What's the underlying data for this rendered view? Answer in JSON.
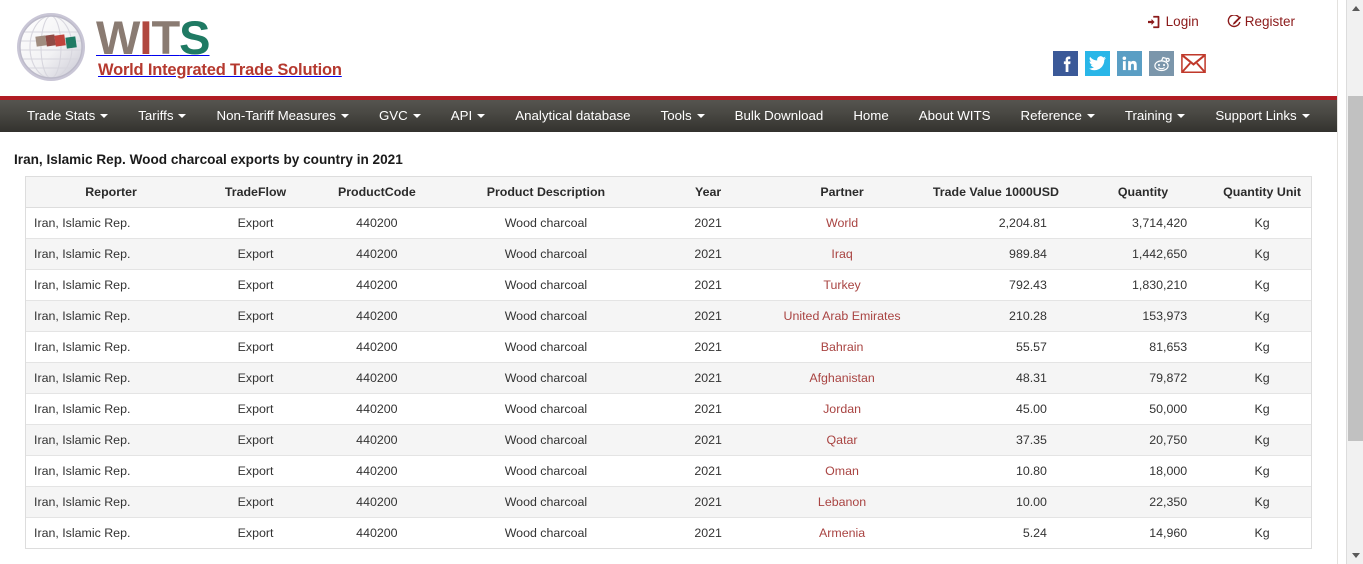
{
  "brand": {
    "logo_icon": "globe-icon",
    "name_parts": {
      "w": "W",
      "i": "I",
      "t": "T",
      "s": "S"
    },
    "tagline": "World Integrated Trade Solution",
    "colors": {
      "wits_w": "#8a7b72",
      "wits_i": "#b1483f",
      "wits_t": "#8a7b72",
      "wits_s": "#1f7a63",
      "tagline": "#b5392f"
    }
  },
  "auth": {
    "login": {
      "label": "Login",
      "icon": "sign-in-icon"
    },
    "register": {
      "label": "Register",
      "icon": "edit-pencil-icon"
    },
    "color": "#8b1a1a"
  },
  "social": [
    {
      "name": "facebook",
      "icon": "facebook-icon",
      "glyph": "f",
      "color": "#3b5998"
    },
    {
      "name": "twitter",
      "icon": "twitter-icon",
      "glyph": "t",
      "color": "#29b6e8"
    },
    {
      "name": "linkedin",
      "icon": "linkedin-icon",
      "glyph": "in",
      "color": "#5a9ec4"
    },
    {
      "name": "reddit",
      "icon": "reddit-icon",
      "glyph": "r",
      "color": "#7b96ab"
    },
    {
      "name": "email",
      "icon": "envelope-icon",
      "glyph": "mail",
      "color": "#c0392b"
    }
  ],
  "navbar": {
    "accent_color": "#b01c23",
    "left": [
      {
        "label": "Trade Stats",
        "caret": true
      },
      {
        "label": "Tariffs",
        "caret": true
      },
      {
        "label": "Non-Tariff Measures",
        "caret": true
      },
      {
        "label": "GVC",
        "caret": true
      },
      {
        "label": "API",
        "caret": true
      },
      {
        "label": "Analytical database",
        "caret": false
      },
      {
        "label": "Tools",
        "caret": true
      },
      {
        "label": "Bulk Download",
        "caret": false
      }
    ],
    "right": [
      {
        "label": "Home",
        "caret": false
      },
      {
        "label": "About WITS",
        "caret": false
      },
      {
        "label": "Reference",
        "caret": true
      },
      {
        "label": "Training",
        "caret": true
      },
      {
        "label": "Support Links",
        "caret": true
      }
    ]
  },
  "main": {
    "title": "Iran, Islamic Rep. Wood charcoal exports by country in 2021",
    "table": {
      "headers": [
        "Reporter",
        "TradeFlow",
        "ProductCode",
        "Product Description",
        "Year",
        "Partner",
        "Trade Value 1000USD",
        "Quantity",
        "Quantity Unit"
      ],
      "partner_link_color": "#a94442",
      "rows": [
        {
          "reporter": "Iran, Islamic Rep.",
          "tradeflow": "Export",
          "productcode": "440200",
          "description": "Wood charcoal",
          "year": "2021",
          "partner": "World",
          "trade_value": "2,204.81",
          "quantity": "3,714,420",
          "unit": "Kg"
        },
        {
          "reporter": "Iran, Islamic Rep.",
          "tradeflow": "Export",
          "productcode": "440200",
          "description": "Wood charcoal",
          "year": "2021",
          "partner": "Iraq",
          "trade_value": "989.84",
          "quantity": "1,442,650",
          "unit": "Kg"
        },
        {
          "reporter": "Iran, Islamic Rep.",
          "tradeflow": "Export",
          "productcode": "440200",
          "description": "Wood charcoal",
          "year": "2021",
          "partner": "Turkey",
          "trade_value": "792.43",
          "quantity": "1,830,210",
          "unit": "Kg"
        },
        {
          "reporter": "Iran, Islamic Rep.",
          "tradeflow": "Export",
          "productcode": "440200",
          "description": "Wood charcoal",
          "year": "2021",
          "partner": "United Arab Emirates",
          "trade_value": "210.28",
          "quantity": "153,973",
          "unit": "Kg"
        },
        {
          "reporter": "Iran, Islamic Rep.",
          "tradeflow": "Export",
          "productcode": "440200",
          "description": "Wood charcoal",
          "year": "2021",
          "partner": "Bahrain",
          "trade_value": "55.57",
          "quantity": "81,653",
          "unit": "Kg"
        },
        {
          "reporter": "Iran, Islamic Rep.",
          "tradeflow": "Export",
          "productcode": "440200",
          "description": "Wood charcoal",
          "year": "2021",
          "partner": "Afghanistan",
          "trade_value": "48.31",
          "quantity": "79,872",
          "unit": "Kg"
        },
        {
          "reporter": "Iran, Islamic Rep.",
          "tradeflow": "Export",
          "productcode": "440200",
          "description": "Wood charcoal",
          "year": "2021",
          "partner": "Jordan",
          "trade_value": "45.00",
          "quantity": "50,000",
          "unit": "Kg"
        },
        {
          "reporter": "Iran, Islamic Rep.",
          "tradeflow": "Export",
          "productcode": "440200",
          "description": "Wood charcoal",
          "year": "2021",
          "partner": "Qatar",
          "trade_value": "37.35",
          "quantity": "20,750",
          "unit": "Kg"
        },
        {
          "reporter": "Iran, Islamic Rep.",
          "tradeflow": "Export",
          "productcode": "440200",
          "description": "Wood charcoal",
          "year": "2021",
          "partner": "Oman",
          "trade_value": "10.80",
          "quantity": "18,000",
          "unit": "Kg"
        },
        {
          "reporter": "Iran, Islamic Rep.",
          "tradeflow": "Export",
          "productcode": "440200",
          "description": "Wood charcoal",
          "year": "2021",
          "partner": "Lebanon",
          "trade_value": "10.00",
          "quantity": "22,350",
          "unit": "Kg"
        },
        {
          "reporter": "Iran, Islamic Rep.",
          "tradeflow": "Export",
          "productcode": "440200",
          "description": "Wood charcoal",
          "year": "2021",
          "partner": "Armenia",
          "trade_value": "5.24",
          "quantity": "14,960",
          "unit": "Kg"
        }
      ]
    }
  },
  "scrollbar": {
    "up_icon": "chevron-up-icon",
    "down_icon": "chevron-down-icon"
  }
}
